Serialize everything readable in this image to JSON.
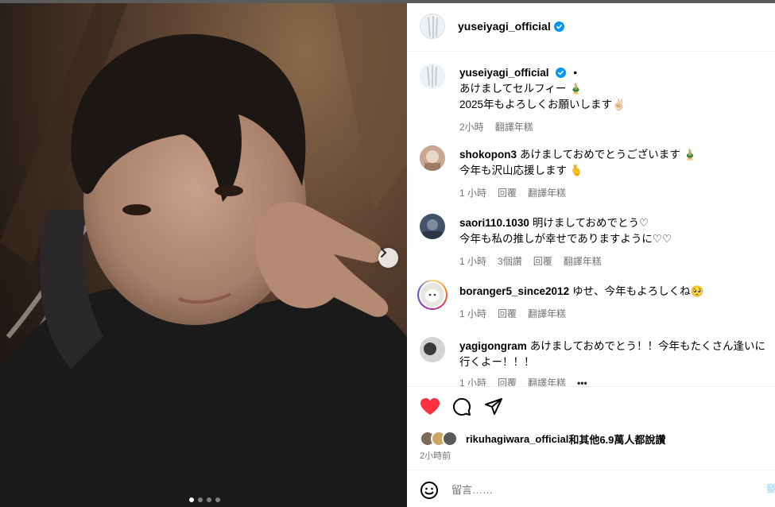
{
  "post": {
    "author": "yuseiyagi_official",
    "carousel": {
      "slides": 4,
      "active_index": 0
    }
  },
  "caption": {
    "username": "yuseiyagi_official",
    "separator": "•",
    "lines": [
      "あけましてセルフィー 🎍",
      "2025年もよろしくお願いします✌🏻"
    ],
    "time": "2小時",
    "translate": "翻譯年糕"
  },
  "comments": [
    {
      "username": "shokopon3",
      "lines": [
        "あけましておめでとうございます 🎍",
        "今年も沢山応援します 🫰"
      ],
      "time": "1 小時",
      "likes": "",
      "reply": "回覆",
      "translate": "翻譯年糕",
      "avatar_color": "#c9a892"
    },
    {
      "username": "saori110.1030",
      "lines": [
        "明けましておめでとう♡",
        "今年も私の推しが幸せでありますように♡♡"
      ],
      "time": "1 小時",
      "likes": "3個讚",
      "reply": "回覆",
      "translate": "翻譯年糕",
      "avatar_color": "#44536a"
    },
    {
      "username": "boranger5_since2012",
      "lines": [
        "ゆせ、今年もよろしくね🥺"
      ],
      "time": "1 小時",
      "likes": "",
      "reply": "回覆",
      "translate": "翻譯年糕",
      "avatar_color": "#e9e6e2"
    },
    {
      "username": "yagigongram",
      "lines": [
        "あけましておめでとう！！今年もたくさん逢いに行くよー！！！"
      ],
      "time": "1 小時",
      "likes": "",
      "reply": "回覆",
      "translate": "翻譯年糕",
      "more": "•••",
      "avatar_color": "#bfbfbf"
    }
  ],
  "likes": {
    "who": "rikuhagiwara_official",
    "rest": "和其他6.9萬人都說讚",
    "avatar_colors": [
      "#7f6a58",
      "#c9a866",
      "#5a5a5a"
    ],
    "liked": true
  },
  "posted_time": "2小時前",
  "compose": {
    "placeholder": "留言……",
    "post_label": "發"
  },
  "colors": {
    "like_red": "#ff3040",
    "verified_blue": "#0095f6",
    "muted": "#737373"
  }
}
